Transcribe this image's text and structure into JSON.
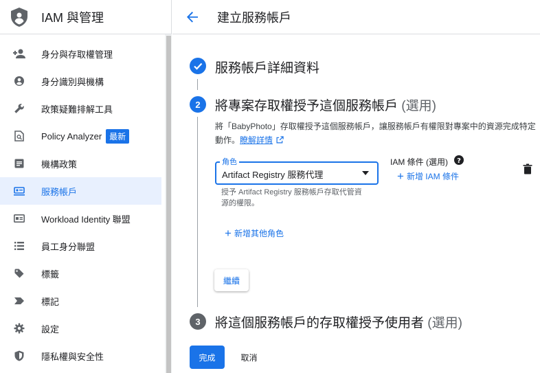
{
  "sidebar": {
    "title": "IAM 與管理",
    "items": [
      {
        "label": "身分與存取權管理",
        "icon": "person-add-icon"
      },
      {
        "label": "身分識別與機構",
        "icon": "account-circle-icon"
      },
      {
        "label": "政策疑難排解工具",
        "icon": "wrench-icon"
      },
      {
        "label": "Policy Analyzer",
        "icon": "document-search-icon",
        "badge": "最新"
      },
      {
        "label": "機構政策",
        "icon": "list-article-icon"
      },
      {
        "label": "服務帳戶",
        "icon": "service-account-icon",
        "active": true
      },
      {
        "label": "Workload Identity 聯盟",
        "icon": "id-card-icon"
      },
      {
        "label": "員工身分聯盟",
        "icon": "list-icon"
      },
      {
        "label": "標籤",
        "icon": "tag-icon"
      },
      {
        "label": "標記",
        "icon": "label-icon"
      },
      {
        "label": "設定",
        "icon": "gear-icon"
      },
      {
        "label": "隱私權與安全性",
        "icon": "shield-icon"
      }
    ]
  },
  "header": {
    "title": "建立服務帳戶"
  },
  "steps": {
    "step1": {
      "title": "服務帳戶詳細資料"
    },
    "step2": {
      "number": "2",
      "title": "將專案存取權授予這個服務帳戶",
      "optional": "(選用)"
    },
    "step3": {
      "number": "3",
      "title": "將這個服務帳戶的存取權授予使用者",
      "optional": "(選用)"
    }
  },
  "grant": {
    "description": "將「BabyPhoto」存取權授予這個服務帳戶，讓服務帳戶有權限對專案中的資源完成特定動作。",
    "learn_more": "瞭解詳情",
    "role_label": "角色",
    "role_value": "Artifact Registry 服務代理",
    "role_help": "授予 Artifact Registry 服務帳戶存取代管資源的權限。",
    "iam_condition_title": "IAM 條件 (選用)",
    "add_condition": "新增 IAM 條件",
    "add_role": "新增其他角色",
    "continue": "繼續"
  },
  "footer": {
    "done": "完成",
    "cancel": "取消"
  },
  "colors": {
    "accent": "#1a73e8",
    "step_inactive": "#5f6368"
  }
}
